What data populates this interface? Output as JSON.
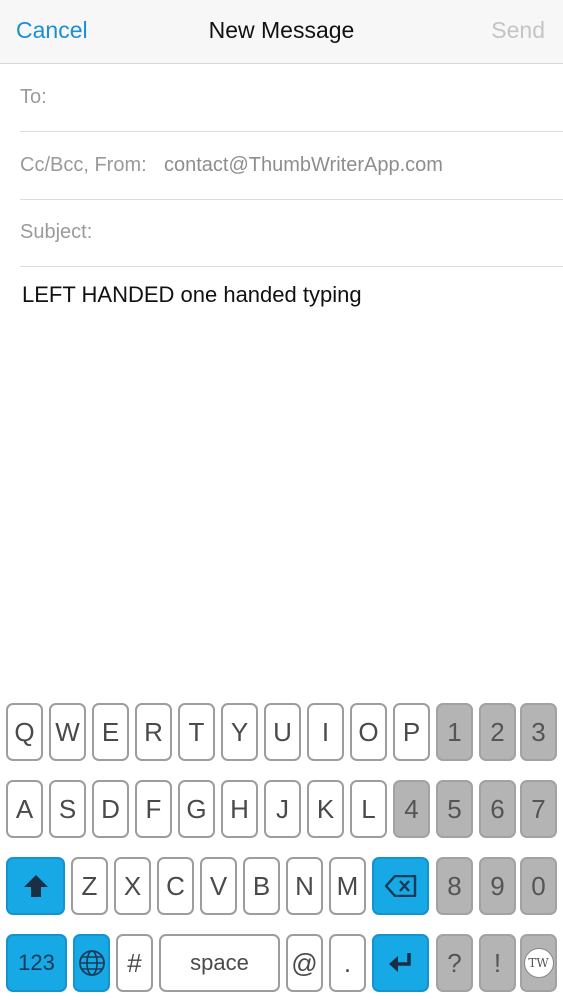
{
  "nav": {
    "cancel": "Cancel",
    "title": "New Message",
    "send": "Send"
  },
  "fields": {
    "to_label": "To:",
    "cc_label": "Cc/Bcc, From:",
    "from_value": "contact@ThumbWriterApp.com",
    "subject_label": "Subject:"
  },
  "body": "LEFT HANDED one handed typing",
  "keyboard": {
    "row1": [
      "Q",
      "W",
      "E",
      "R",
      "T",
      "Y",
      "U",
      "I",
      "O",
      "P",
      "1",
      "2",
      "3"
    ],
    "row2": [
      "A",
      "S",
      "D",
      "F",
      "G",
      "H",
      "J",
      "K",
      "L",
      "4",
      "5",
      "6",
      "7"
    ],
    "row3": [
      "Z",
      "X",
      "C",
      "V",
      "B",
      "N",
      "M",
      "8",
      "9",
      "0"
    ],
    "row4": {
      "numbers": "123",
      "hash": "#",
      "space": "space",
      "at": "@",
      "period": ".",
      "question": "?",
      "exclaim": "!",
      "logo": "TW"
    }
  },
  "colors": {
    "accent": "#1a8fd6",
    "key_blue": "#17a8e6",
    "key_gray": "#b4b4b4"
  }
}
